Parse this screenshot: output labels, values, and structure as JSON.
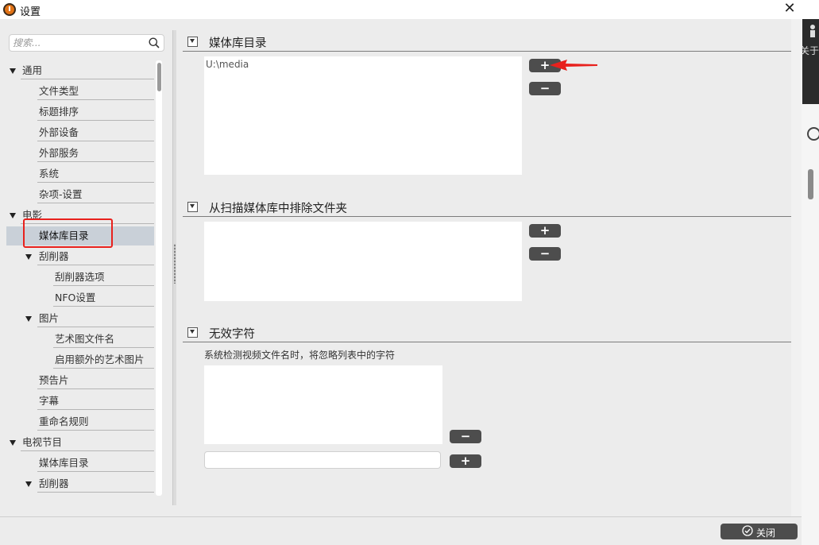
{
  "titlebar": {
    "title": "设置"
  },
  "search": {
    "placeholder": "搜索..."
  },
  "tree": {
    "items": [
      {
        "label": "通用",
        "level": 0,
        "expanded": true
      },
      {
        "label": "文件类型",
        "level": 1
      },
      {
        "label": "标题排序",
        "level": 1
      },
      {
        "label": "外部设备",
        "level": 1
      },
      {
        "label": "外部服务",
        "level": 1
      },
      {
        "label": "系统",
        "level": 1
      },
      {
        "label": "杂项-设置",
        "level": 1
      },
      {
        "label": "电影",
        "level": 0,
        "expanded": true
      },
      {
        "label": "媒体库目录",
        "level": 1,
        "selected": true
      },
      {
        "label": "刮削器",
        "level": 1,
        "expanded": true
      },
      {
        "label": "刮削器选项",
        "level": 2
      },
      {
        "label": "NFO设置",
        "level": 2
      },
      {
        "label": "图片",
        "level": 1,
        "expanded": true
      },
      {
        "label": "艺术图文件名",
        "level": 2
      },
      {
        "label": "启用额外的艺术图片",
        "level": 2
      },
      {
        "label": "预告片",
        "level": 1
      },
      {
        "label": "字幕",
        "level": 1
      },
      {
        "label": "重命名规则",
        "level": 1
      },
      {
        "label": "电视节目",
        "level": 0,
        "expanded": true
      },
      {
        "label": "媒体库目录",
        "level": 1
      },
      {
        "label": "刮削器",
        "level": 1,
        "expanded": true
      }
    ]
  },
  "sections": {
    "media_dirs": {
      "title": "媒体库目录",
      "items": [
        "U:\\media"
      ],
      "add_label": "+",
      "remove_label": "−"
    },
    "exclude": {
      "title": "从扫描媒体库中排除文件夹",
      "add_label": "+",
      "remove_label": "−"
    },
    "invalid_chars": {
      "title": "无效字符",
      "hint": "系统检测视频文件名时，将忽略列表中的字符",
      "input_value": "",
      "add_label": "+",
      "remove_label": "−"
    }
  },
  "footer": {
    "close_label": "关闭"
  },
  "background": {
    "partial_text": "关于"
  },
  "colors": {
    "annotation": "#e8211d",
    "button": "#4d4d4d",
    "selection": "#c9d0d8",
    "app_icon": "#e27316"
  }
}
